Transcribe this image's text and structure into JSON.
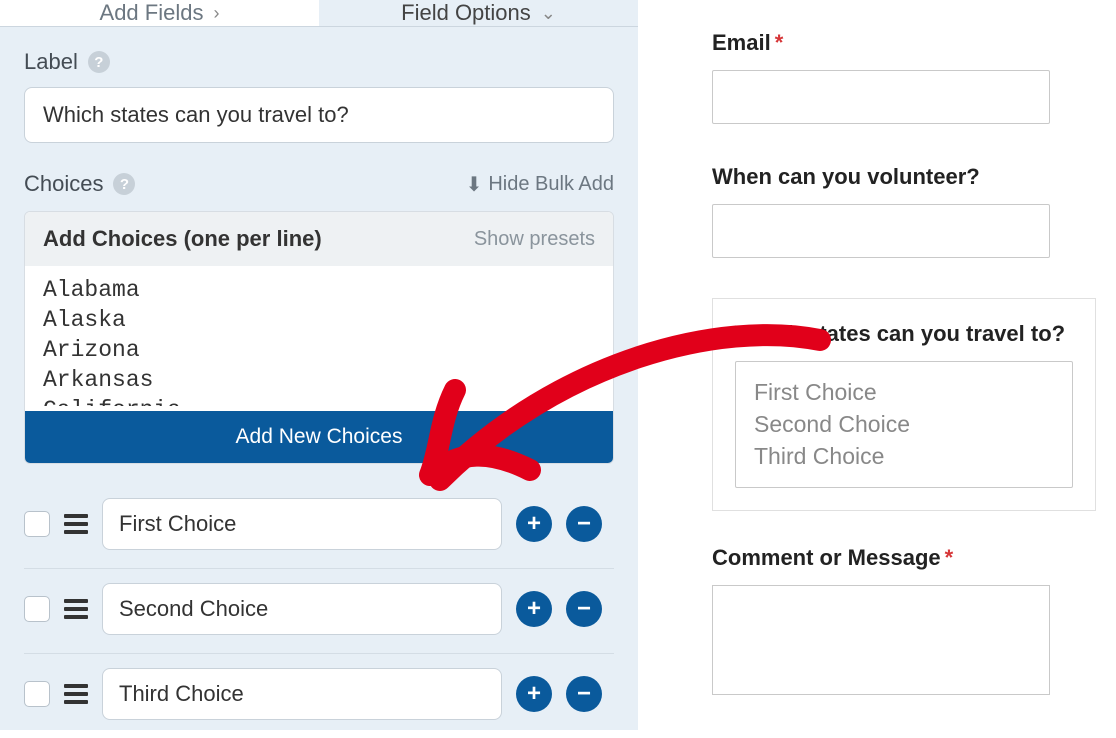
{
  "tabs": {
    "add_fields": "Add Fields",
    "field_options": "Field Options"
  },
  "label_section": {
    "title": "Label",
    "value": "Which states can you travel to?"
  },
  "choices_section": {
    "title": "Choices",
    "hide_bulk": "Hide Bulk Add",
    "bulk_title": "Add Choices (one per line)",
    "show_presets": "Show presets",
    "bulk_text": "Alabama\nAlaska\nArizona\nArkansas\nCalifornia",
    "add_button": "Add New Choices",
    "items": [
      {
        "label": "First Choice"
      },
      {
        "label": "Second Choice"
      },
      {
        "label": "Third Choice"
      }
    ]
  },
  "preview": {
    "email": {
      "label": "Email",
      "required": true
    },
    "volunteer": {
      "label": "When can you volunteer?"
    },
    "states": {
      "label": "Which states can you travel to?",
      "options": [
        "First Choice",
        "Second Choice",
        "Third Choice"
      ]
    },
    "comment": {
      "label": "Comment or Message",
      "required": true
    }
  },
  "glyphs": {
    "help": "?",
    "plus": "+",
    "minus": "−",
    "chev_right": "›",
    "chev_down": "⌄",
    "download": "⬇",
    "asterisk": "*"
  }
}
